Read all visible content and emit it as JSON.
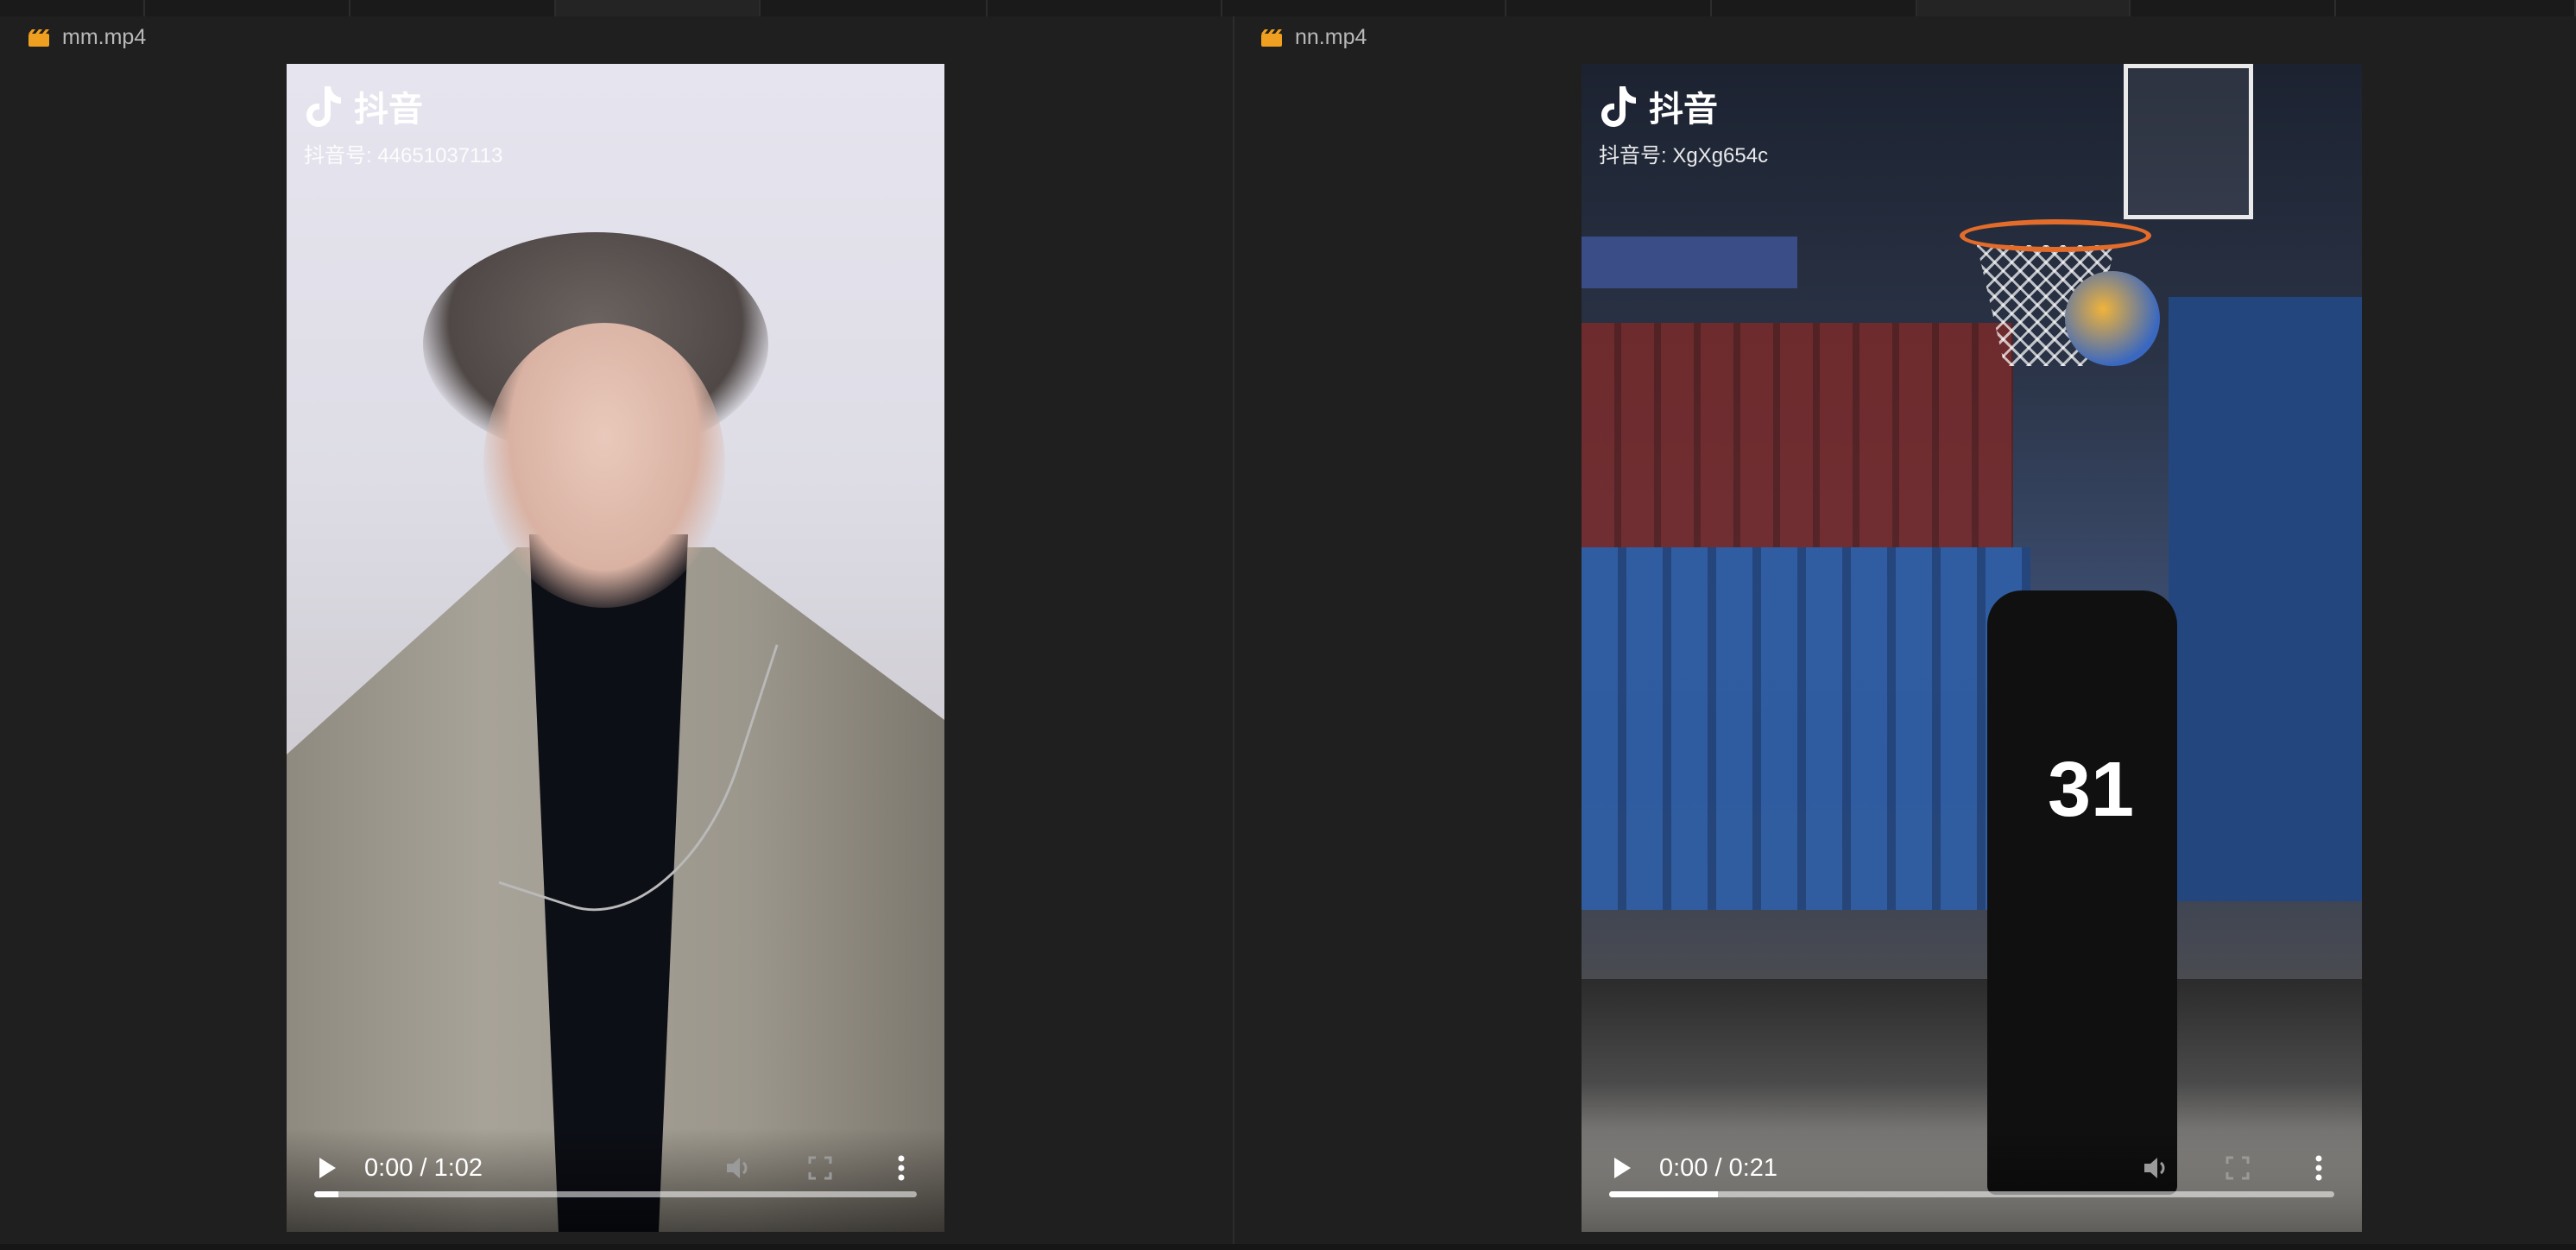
{
  "panes": [
    {
      "filename": "mm.mp4",
      "watermark": {
        "brand": "抖音",
        "id": "抖音号: 44651037113"
      },
      "player": {
        "time": "0:00 / 1:02",
        "progress_fraction": 0.04
      }
    },
    {
      "filename": "nn.mp4",
      "watermark": {
        "brand": "抖音",
        "id": "抖音号: XgXg654c"
      },
      "player": {
        "time": "0:00 / 0:21",
        "progress_fraction": 0.15,
        "jersey_number": "31"
      }
    }
  ],
  "icons": {
    "file": "clapperboard-icon",
    "play": "play-icon",
    "volume": "volume-icon",
    "fullscreen": "fullscreen-icon",
    "more": "more-vertical-icon",
    "brand": "tiktok-icon"
  },
  "colors": {
    "background": "#202020",
    "file_icon": "#f0a020",
    "label_text": "#b9b9b9",
    "control_text": "#ffffff"
  }
}
